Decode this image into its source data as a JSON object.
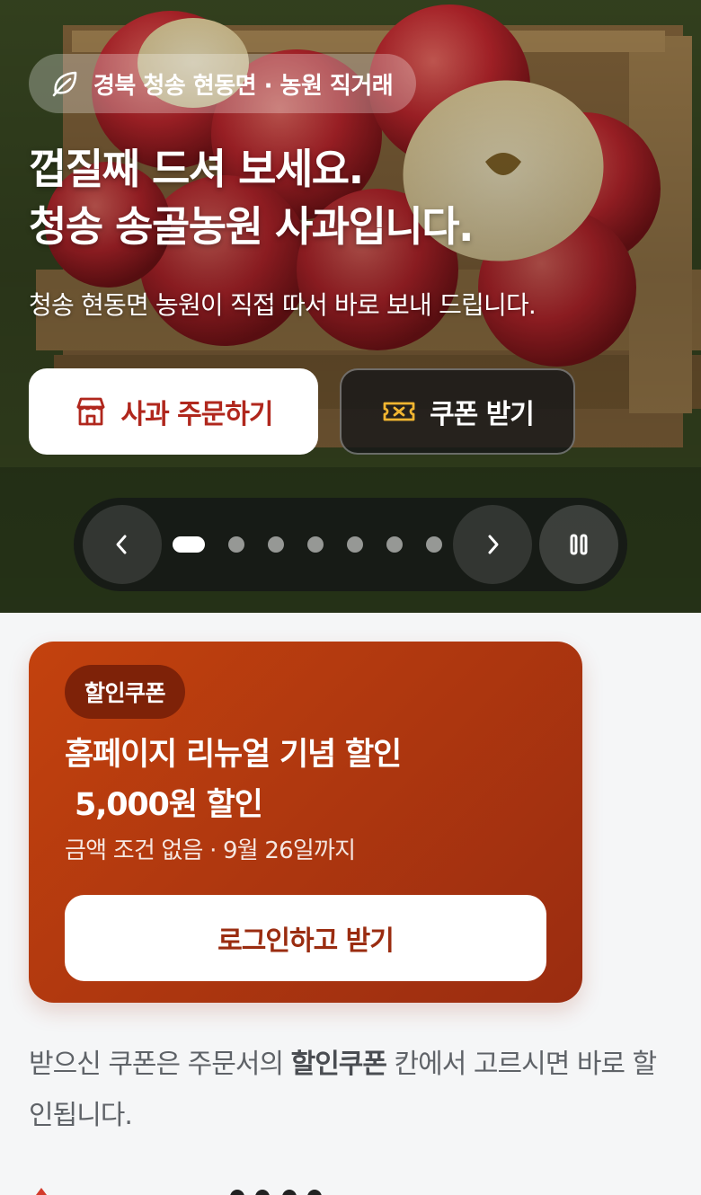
{
  "hero": {
    "location_chip": "경북 청송 현동면 · 농원 직거래",
    "title_line1": "껍질째 드셔 보세요.",
    "title_line2": "청송 송골농원 사과입니다.",
    "subtitle": "청송 현동면 농원이 직접 따서 바로 보내 드립니다.",
    "order_button": "사과 주문하기",
    "coupon_button": "쿠폰 받기",
    "carousel": {
      "slide_count": 7,
      "active_index": 0
    },
    "icons": {
      "location": "leaf-icon",
      "order": "store-icon",
      "coupon": "ticket-icon",
      "prev": "chevron-left-icon",
      "next": "chevron-right-icon",
      "pause": "pause-icon"
    }
  },
  "coupon_card": {
    "badge": "할인쿠폰",
    "title": "홈페이지 리뉴얼 기념 할인\n 5,000원 할인",
    "condition": "금액 조건 없음 · 9월 26일까지",
    "button": "로그인하고 받기"
  },
  "note": {
    "before": "받으신 쿠폰은 주문서의 ",
    "strong": "할인쿠폰",
    "after": " 칸에서 고르시면 바로 할인됩니다."
  },
  "colors": {
    "accent_red": "#b0271d",
    "coupon_card": "#b0380f",
    "coupon_badge": "#7e2208",
    "ticket_yellow": "#f2b631"
  }
}
